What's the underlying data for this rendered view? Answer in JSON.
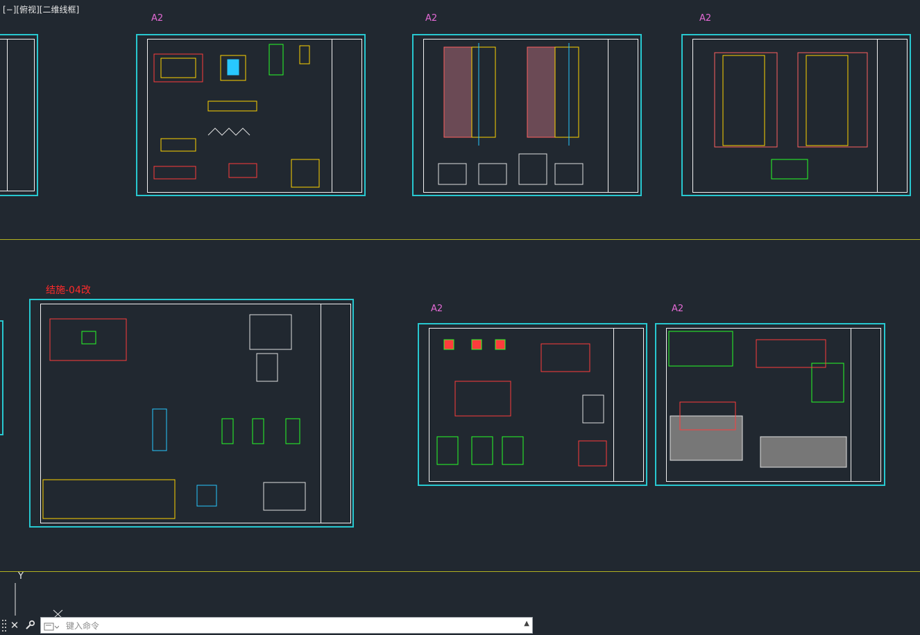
{
  "viewport": {
    "label": "[−][俯视][二维线框]"
  },
  "sheets": [
    {
      "name": "sheet-top-1",
      "size_label": "A2"
    },
    {
      "name": "sheet-top-2",
      "size_label": "A2"
    },
    {
      "name": "sheet-top-3",
      "size_label": "A2"
    },
    {
      "name": "sheet-bottom-1",
      "title_label": "结施-04改"
    },
    {
      "name": "sheet-bottom-2",
      "size_label": "A2"
    },
    {
      "name": "sheet-bottom-3",
      "size_label": "A2"
    }
  ],
  "ucs": {
    "y_label": "Y"
  },
  "command_line": {
    "placeholder": "键入命令",
    "close_icon": "close-icon",
    "settings_icon": "wrench-icon"
  },
  "colors": {
    "background": "#212830",
    "sheet_border": "#28c8d0",
    "divider": "#b3b320",
    "size_label": "#e46ad6",
    "title_label": "#ff2a2a"
  }
}
